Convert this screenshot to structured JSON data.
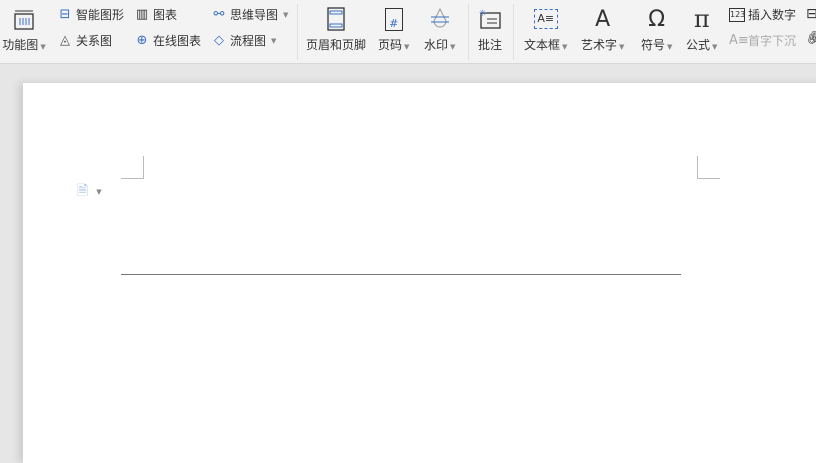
{
  "toolbar": {
    "function_chart": "功能图",
    "smart_shape": "智能图形",
    "chart": "图表",
    "mind_map": "思维导图",
    "relation": "关系图",
    "online_chart": "在线图表",
    "flowchart": "流程图",
    "header_footer": "页眉和页脚",
    "page_number": "页码",
    "watermark": "水印",
    "comment": "批注",
    "textbox": "文本框",
    "wordart": "艺术字",
    "symbol": "符号",
    "formula": "公式",
    "insert_number": "插入数字",
    "drop_cap": "首字下沉",
    "page_num_glyph": "#",
    "insert_number_glyph": "123"
  },
  "colors": {
    "accent": "#3a6fc4",
    "toolbar_bg": "#f3f3f3",
    "canvas_bg": "#e6e6e6"
  }
}
